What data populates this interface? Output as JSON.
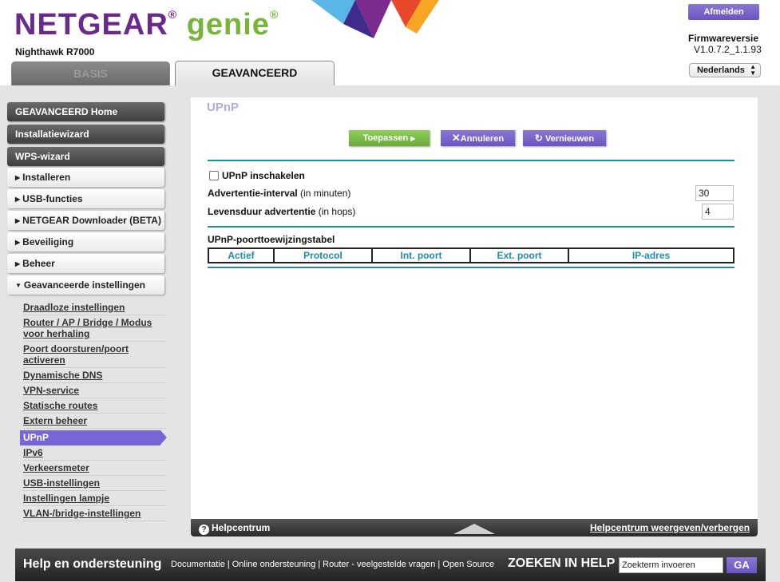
{
  "header": {
    "brand_netgear": "NETGEAR",
    "brand_genie": "genie",
    "model": "Nighthawk R7000",
    "logout_label": "Afmelden",
    "firmware_label": "Firmwareversie",
    "firmware_version": "V1.0.7.2_1.1.93",
    "language": "Nederlands",
    "tabs": [
      {
        "label": "BASIS",
        "active": false
      },
      {
        "label": "GEAVANCEERD",
        "active": true
      }
    ]
  },
  "sidebar": {
    "buttons": [
      {
        "label": "GEAVANCEERD Home"
      },
      {
        "label": "Installatiewizard"
      },
      {
        "label": "WPS-wizard"
      }
    ],
    "sections": [
      {
        "label": "Installeren"
      },
      {
        "label": "USB-functies"
      },
      {
        "label": "NETGEAR Downloader (BETA)"
      },
      {
        "label": "Beveiliging"
      },
      {
        "label": "Beheer"
      },
      {
        "label": "Geavanceerde instellingen"
      }
    ],
    "subitems": [
      {
        "label": "Draadloze instellingen"
      },
      {
        "label": "Router / AP / Bridge / Modus voor herhaling"
      },
      {
        "label": "Poort doorsturen/poort activeren"
      },
      {
        "label": "Dynamische DNS"
      },
      {
        "label": "VPN-service"
      },
      {
        "label": "Statische routes"
      },
      {
        "label": "Extern beheer"
      },
      {
        "label": "UPnP",
        "active": true
      },
      {
        "label": "IPv6"
      },
      {
        "label": "Verkeersmeter"
      },
      {
        "label": "USB-instellingen"
      },
      {
        "label": "Instellingen lampje"
      },
      {
        "label": "VLAN-/bridge-instellingen"
      }
    ]
  },
  "main": {
    "title": "UPnP",
    "apply_label": "Toepassen",
    "cancel_label": "Annuleren",
    "refresh_label": "Vernieuwen",
    "enable_label": "UPnP inschakelen",
    "enable_checked": false,
    "adv_interval_bold": "Advertentie-interval",
    "adv_interval_unit": "(in minuten)",
    "adv_interval_value": "30",
    "adv_ttl_bold": "Levensduur advertentie",
    "adv_ttl_unit": "(in hops)",
    "adv_ttl_value": "4",
    "table_title": "UPnP-poorttoewijzingstabel",
    "table_headers": [
      "Actief",
      "Protocol",
      "Int. poort",
      "Ext. poort",
      "IP-adres"
    ]
  },
  "helpbar": {
    "left": "Helpcentrum",
    "right": "Helpcentrum weergeven/verbergen"
  },
  "footer": {
    "title": "Help en ondersteuning",
    "links": [
      "Documentatie",
      "Online ondersteuning",
      "Router - veelgestelde vragen",
      "Open Source"
    ],
    "search_label": "ZOEKEN IN HELP",
    "search_placeholder": "Zoekterm invoeren",
    "go_label": "GA"
  },
  "colors": {
    "brand_purple": "#6b2a8a",
    "brand_green": "#77b53a",
    "accent_purple": "#7866d4",
    "teal": "#1e8ea6",
    "apply_green": "#7dbf4a"
  }
}
